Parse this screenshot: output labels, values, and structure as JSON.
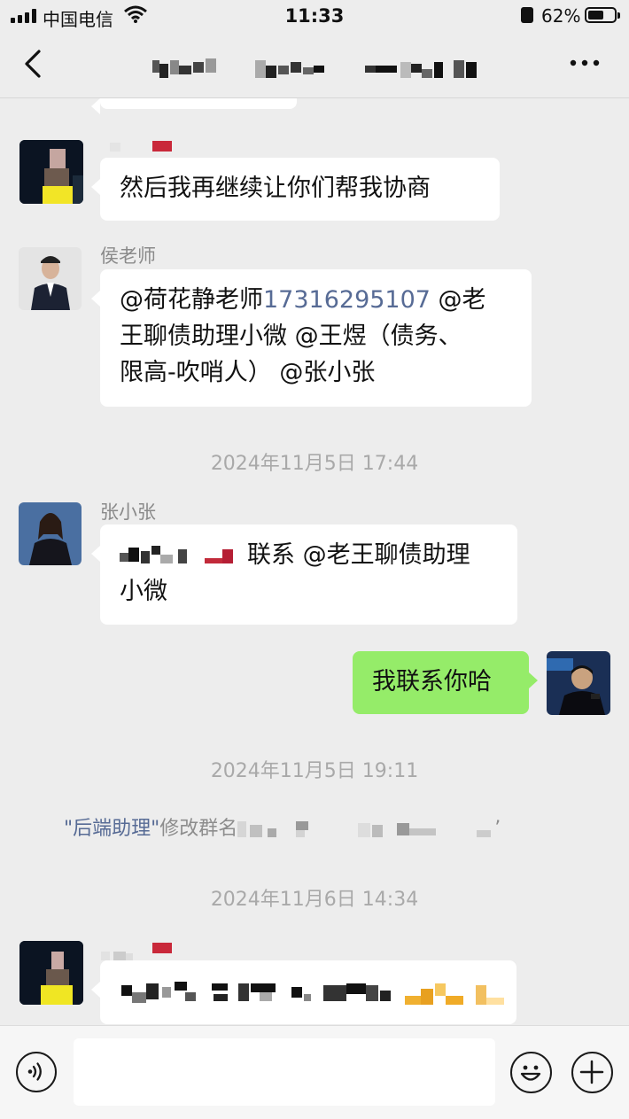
{
  "status_bar": {
    "carrier": "中国电信",
    "time": "11:33",
    "battery_percent": "62%",
    "battery_level": 0.62
  },
  "nav": {
    "back_icon": "chevron-left-icon",
    "more_icon": "more-dots-icon"
  },
  "messages": [
    {
      "id": "m1",
      "side": "left",
      "text": "然后我再继续让你们帮我协商"
    },
    {
      "id": "m2",
      "side": "left",
      "sender": "侯老师",
      "line1_a": "@荷花静老师",
      "line1_phone": "17316295107",
      "line1_b": " @老",
      "line2": "王聊债助理小微 @王煜（债务、",
      "line3": "限高-吹哨人） @张小张"
    },
    {
      "id": "t1",
      "type": "time",
      "text": "2024年11月5日 17:44"
    },
    {
      "id": "m3",
      "side": "left",
      "sender": "张小张",
      "line1": "联系 @老王聊债助理",
      "line2": "小微"
    },
    {
      "id": "m4",
      "side": "right",
      "text": "我联系你哈"
    },
    {
      "id": "t2",
      "type": "time",
      "text": "2024年11月5日 19:11"
    },
    {
      "id": "s1",
      "type": "system",
      "quote_open": "\"",
      "actor": "后端助理",
      "quote_close": "\"",
      "action": "修改群名",
      "end_quote": "’"
    },
    {
      "id": "t3",
      "type": "time",
      "text": "2024年11月6日 14:34"
    }
  ],
  "input_bar": {
    "placeholder": "",
    "voice_icon": "voice-icon",
    "emoji_icon": "emoji-icon",
    "plus_icon": "plus-icon"
  },
  "colors": {
    "background": "#ededed",
    "bubble_self": "#95ec69",
    "bubble_other": "#ffffff",
    "link": "#576b95"
  }
}
